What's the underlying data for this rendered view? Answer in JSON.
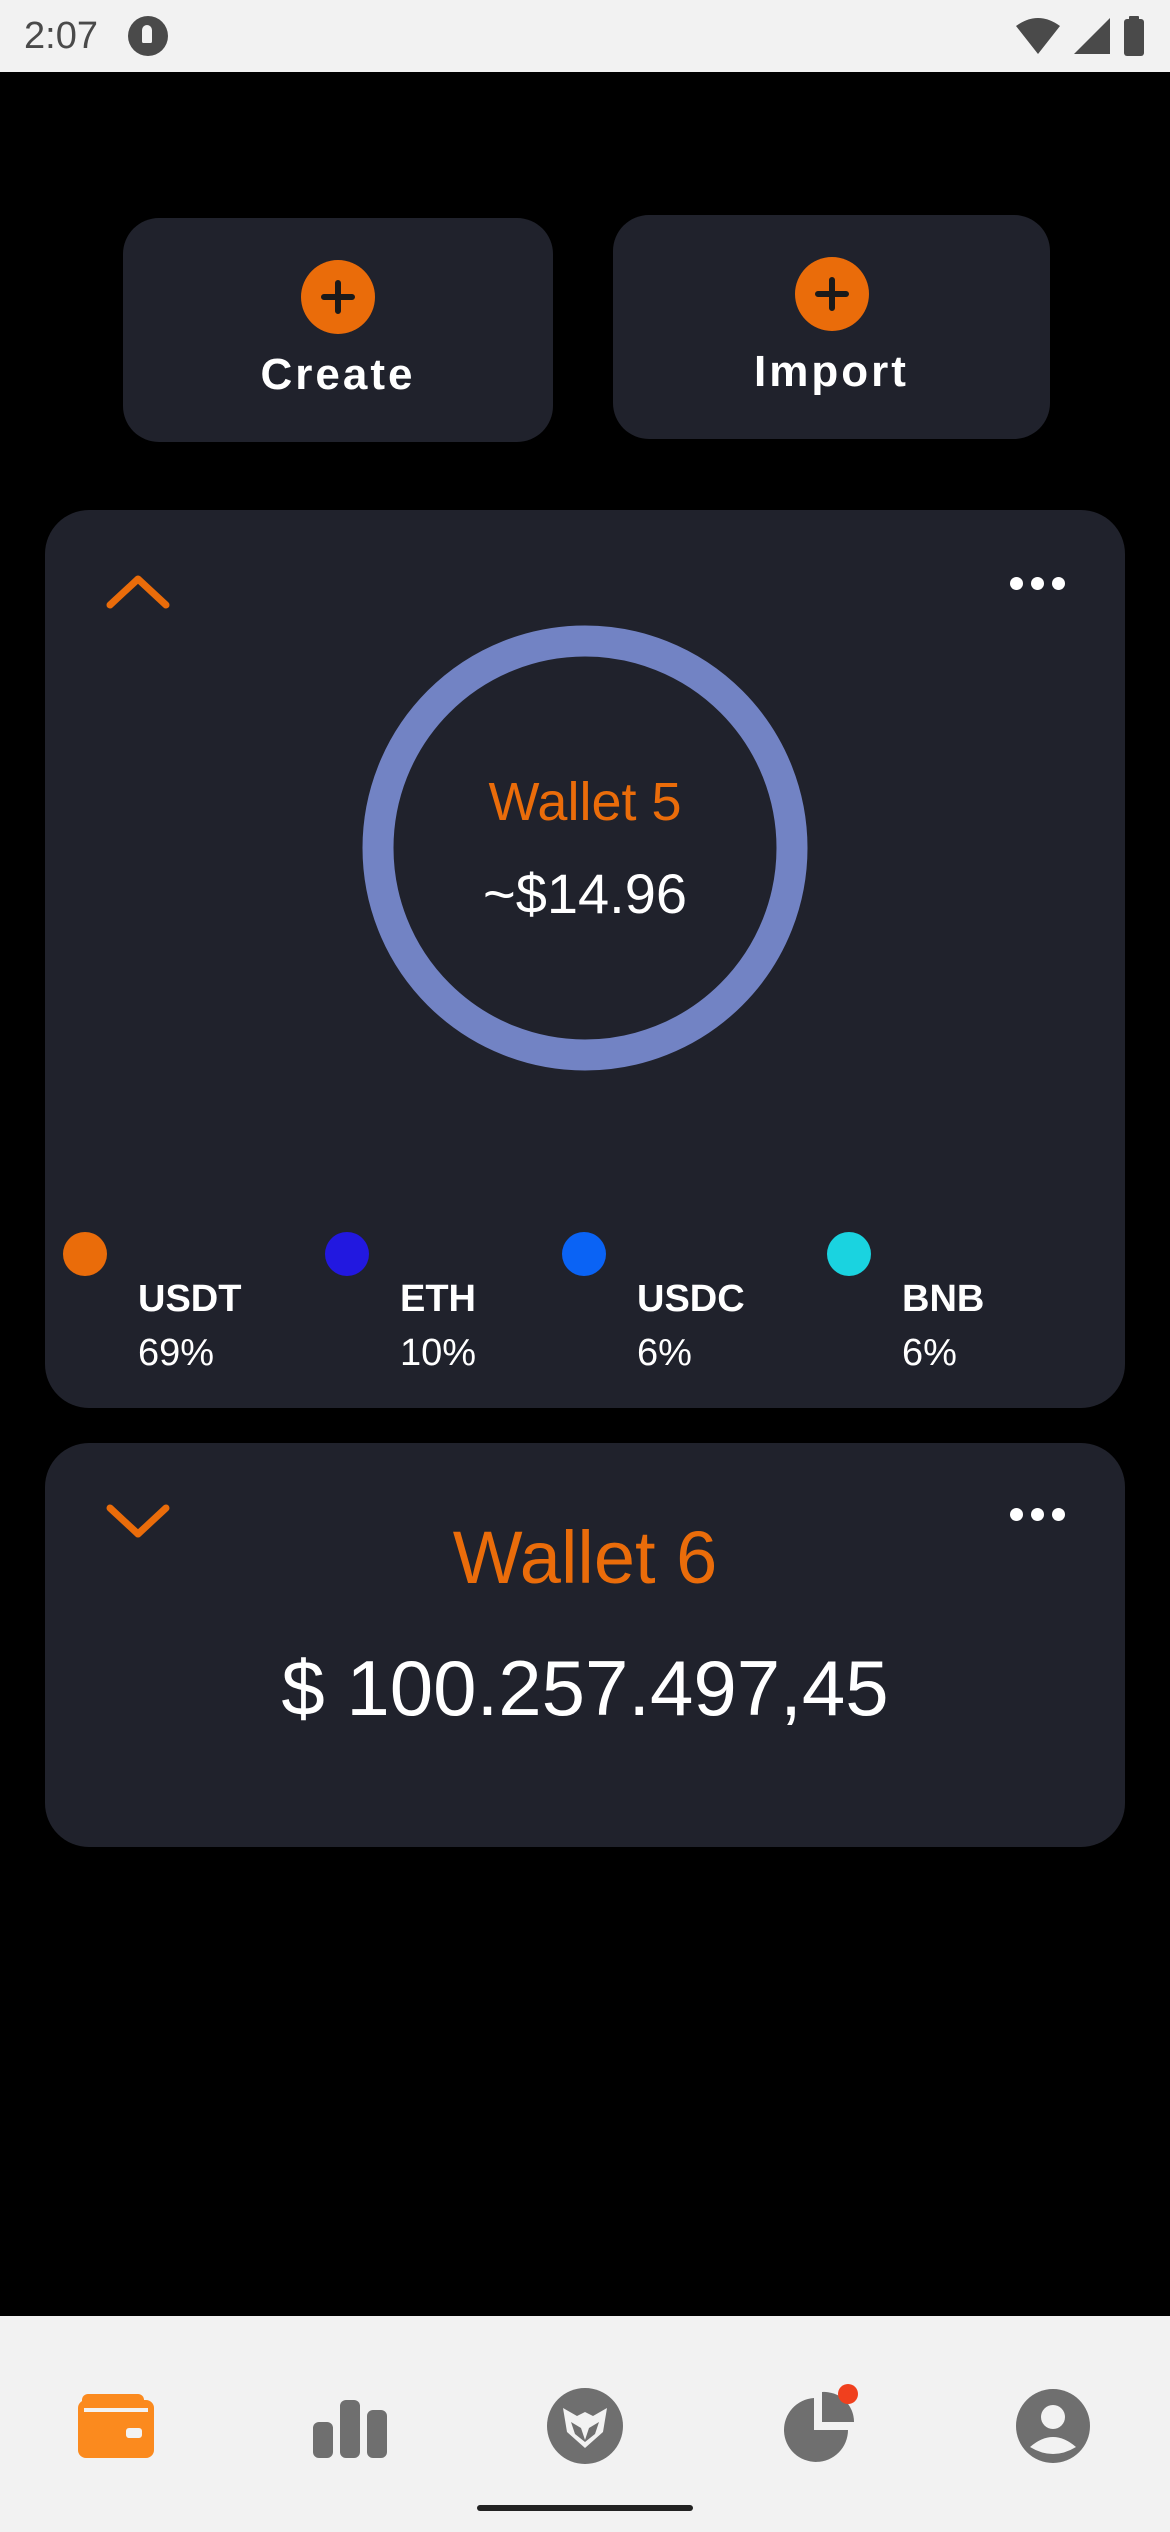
{
  "status_bar": {
    "time": "2:07"
  },
  "actions": {
    "create_label": "Create",
    "import_label": "Import"
  },
  "wallet5": {
    "name": "Wallet 5",
    "amount": "~$14.96",
    "ring_color": "#7283c4",
    "legend": [
      {
        "symbol": "USDT",
        "percent": "69%",
        "color": "#ea6c0a"
      },
      {
        "symbol": "ETH",
        "percent": "10%",
        "color": "#2218e0"
      },
      {
        "symbol": "USDC",
        "percent": "6%",
        "color": "#0a63f5"
      },
      {
        "symbol": "BNB",
        "percent": "6%",
        "color": "#1ad3e0"
      }
    ]
  },
  "wallet6": {
    "name": "Wallet 6",
    "amount": "$ 100.257.497,45"
  },
  "bottom_nav": {
    "items": [
      {
        "icon": "wallet-icon",
        "active": true
      },
      {
        "icon": "bar-chart-icon",
        "active": false
      },
      {
        "icon": "fox-logo-icon",
        "active": false
      },
      {
        "icon": "pie-chart-icon",
        "active": false,
        "badge": true
      },
      {
        "icon": "profile-icon",
        "active": false
      }
    ]
  },
  "colors": {
    "accent": "#ea6c0a",
    "card": "#20222c",
    "background": "#000000",
    "nav_background": "#f2f2f2",
    "nav_icon": "#6f6f6f",
    "badge": "#f0401e"
  }
}
